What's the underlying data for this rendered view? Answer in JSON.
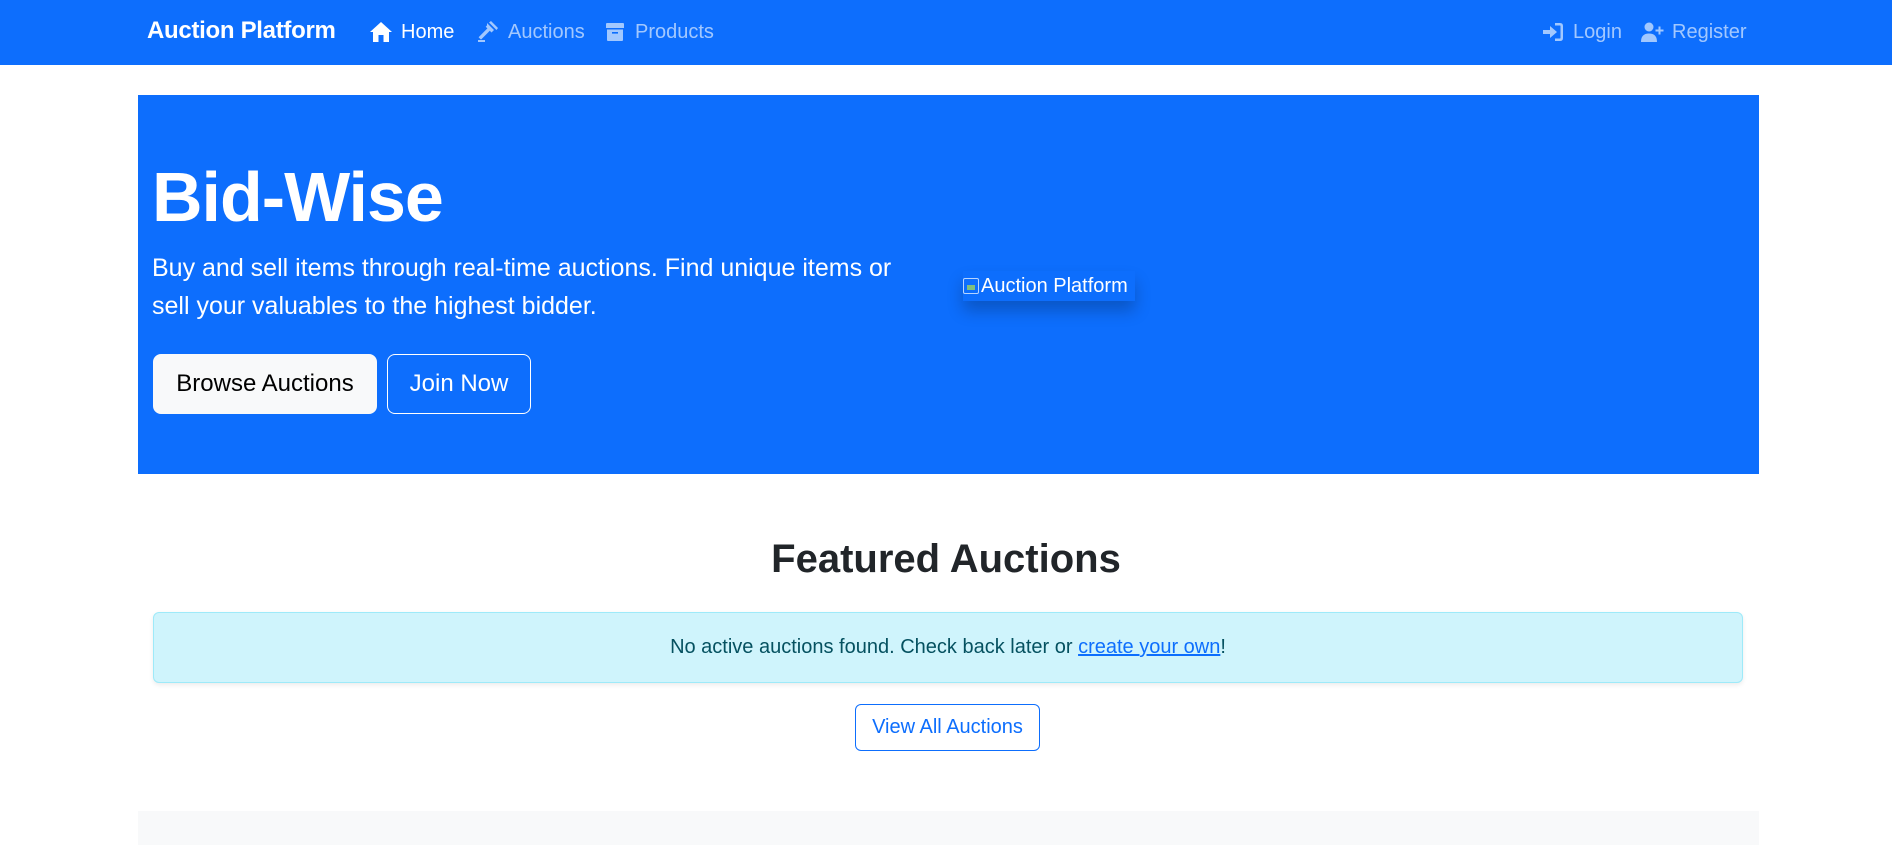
{
  "navbar": {
    "brand": "Auction Platform",
    "links": [
      {
        "label": "Home",
        "icon": "home-icon",
        "active": true
      },
      {
        "label": "Auctions",
        "icon": "gavel-icon",
        "active": false
      },
      {
        "label": "Products",
        "icon": "box-icon",
        "active": false
      }
    ],
    "right_links": [
      {
        "label": "Login",
        "icon": "sign-in-icon"
      },
      {
        "label": "Register",
        "icon": "user-plus-icon"
      }
    ]
  },
  "hero": {
    "title": "Bid-Wise",
    "lead": "Buy and sell items through real-time auctions. Find unique items or sell your valuables to the highest bidder.",
    "primary_button": "Browse Auctions",
    "secondary_button": "Join Now",
    "image_alt": "Auction Platform"
  },
  "featured": {
    "title": "Featured Auctions",
    "alert_text": "No active auctions found. Check back later or ",
    "alert_link": "create your own",
    "alert_suffix": "!",
    "view_all_button": "View All Auctions"
  },
  "colors": {
    "primary": "#0d6efd",
    "alert_bg": "#cff4fc",
    "alert_text": "#055160",
    "light": "#f8f9fa"
  }
}
